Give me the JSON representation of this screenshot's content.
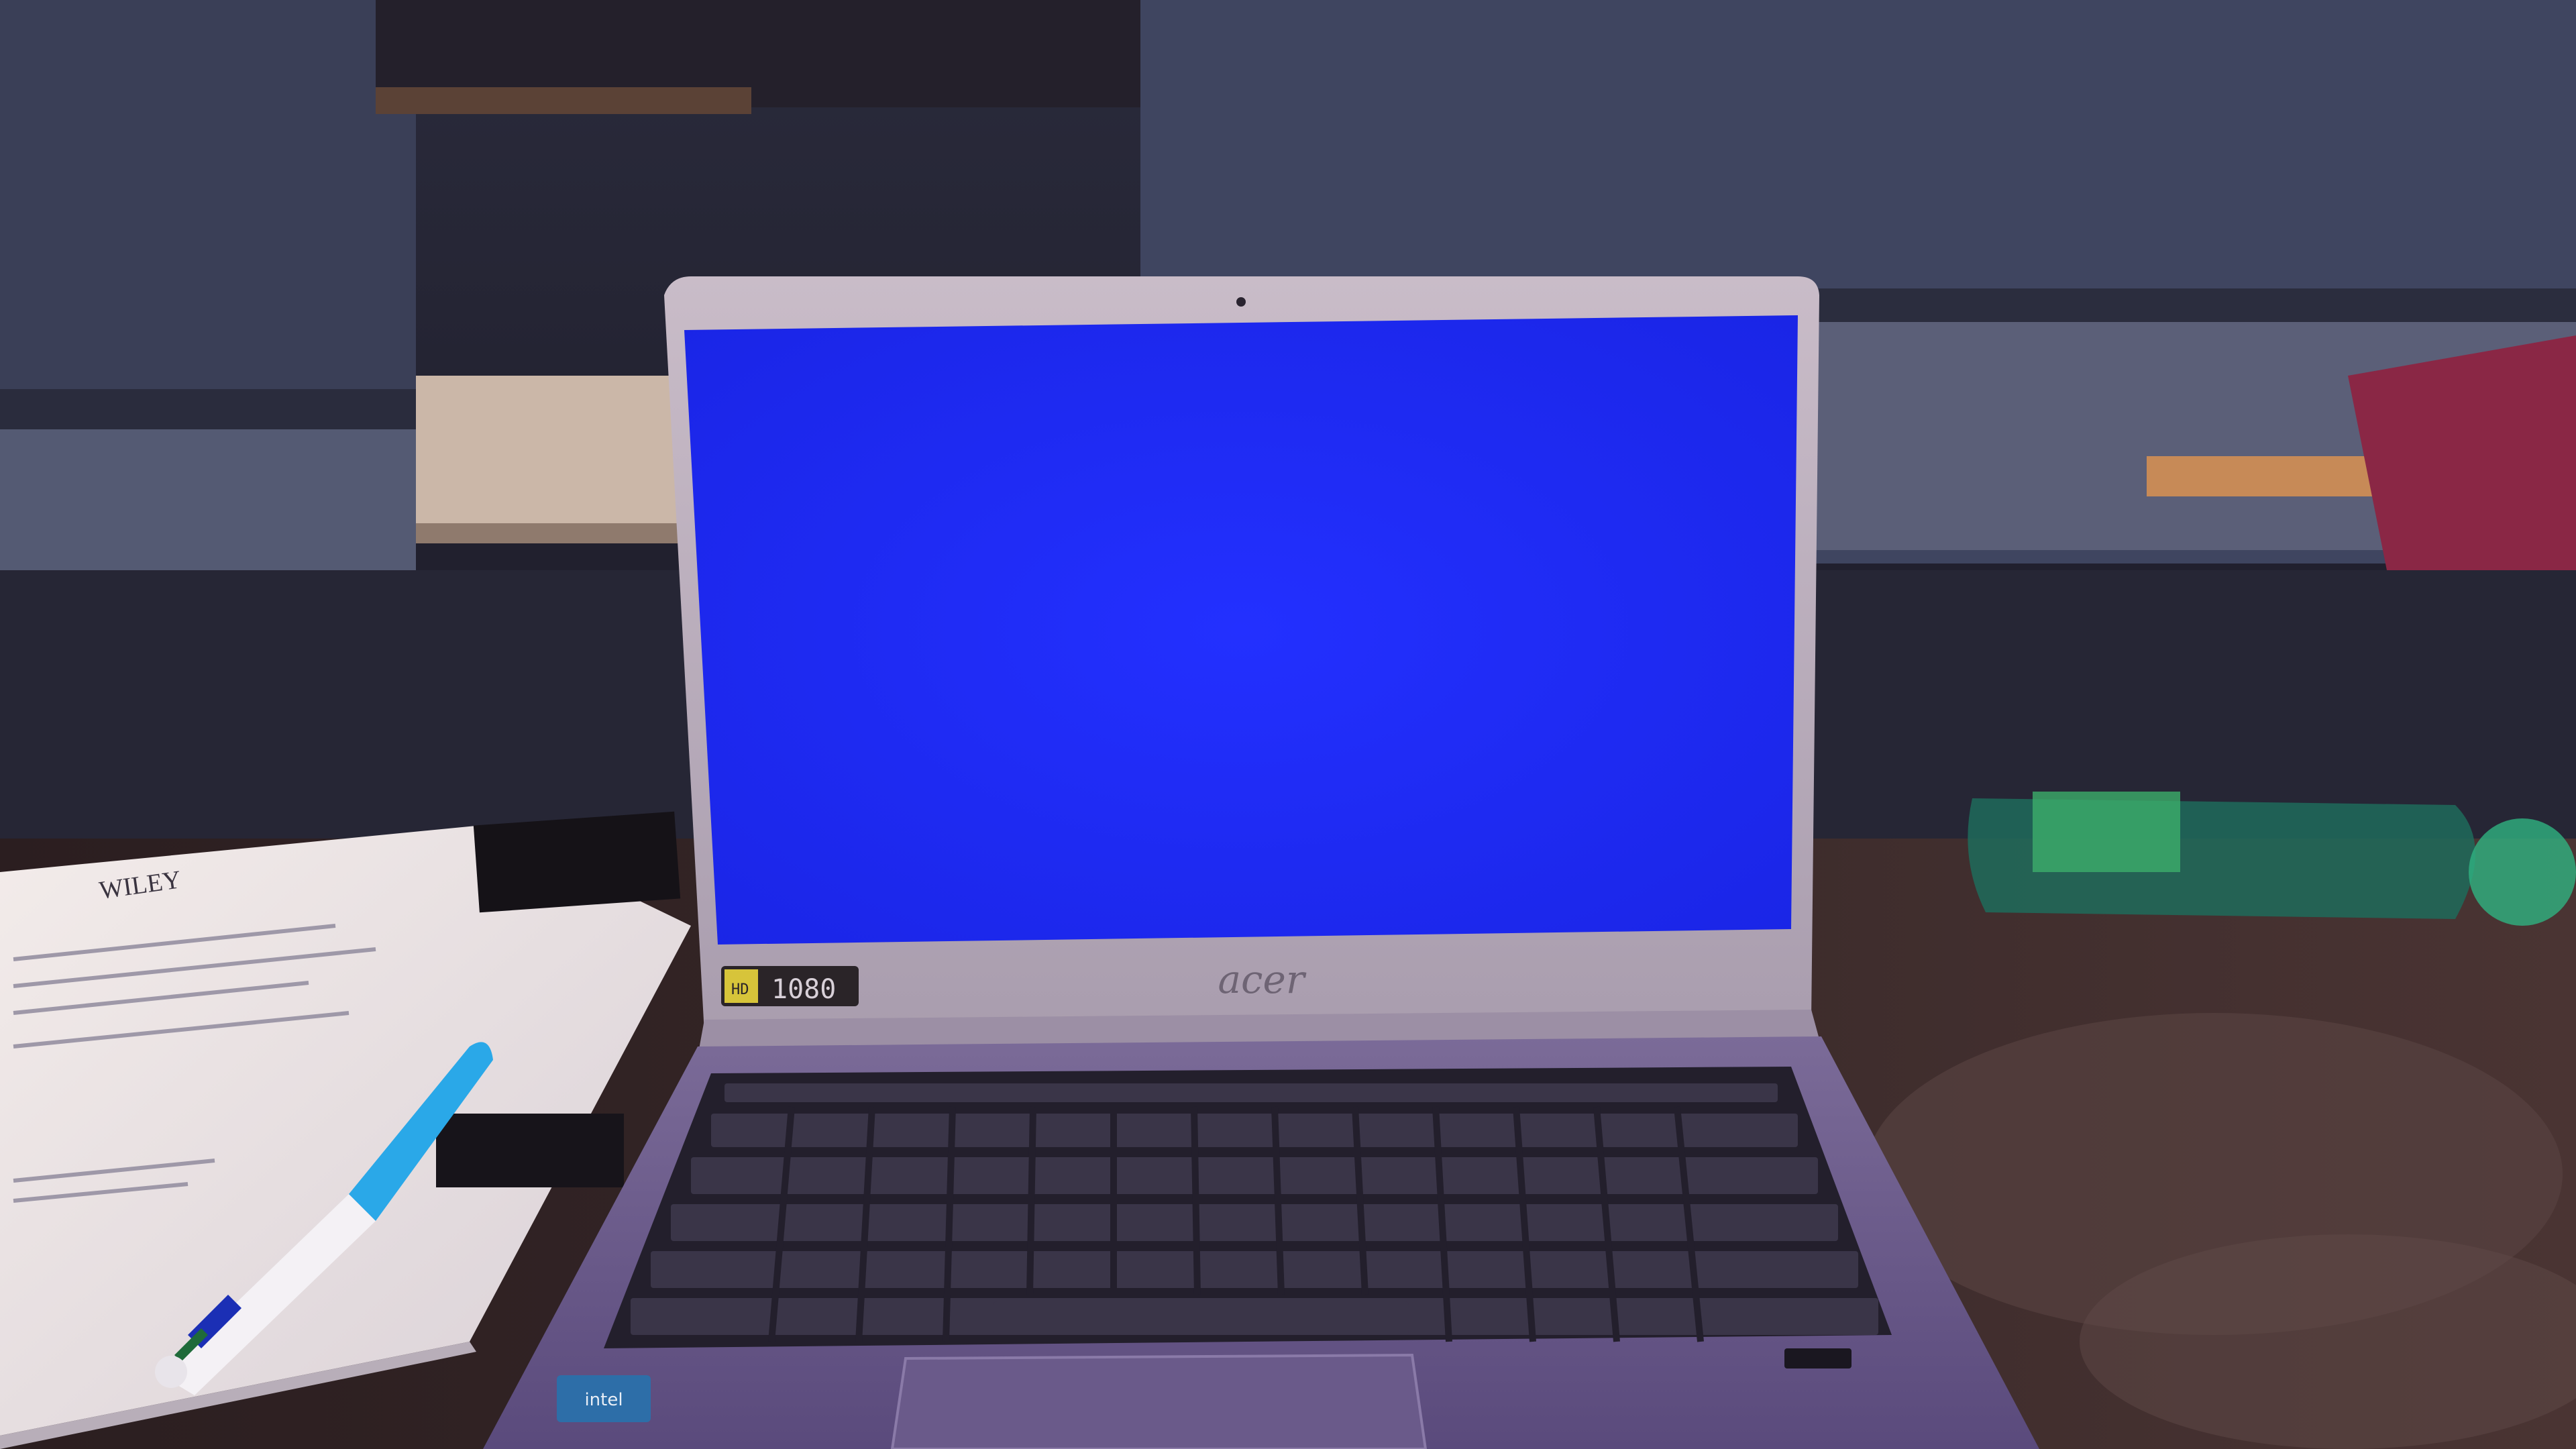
{
  "scene": {
    "screen_color": "#1a25f2",
    "laptop": {
      "brand": "acer",
      "badge_hd": "HD",
      "badge_resolution": "1080",
      "sticker": "intel"
    },
    "paper": {
      "letterhead": "WILEY"
    },
    "pen": {
      "colors": [
        "#2aa8e8",
        "#1b2fb5",
        "#1f6b3a"
      ]
    }
  }
}
